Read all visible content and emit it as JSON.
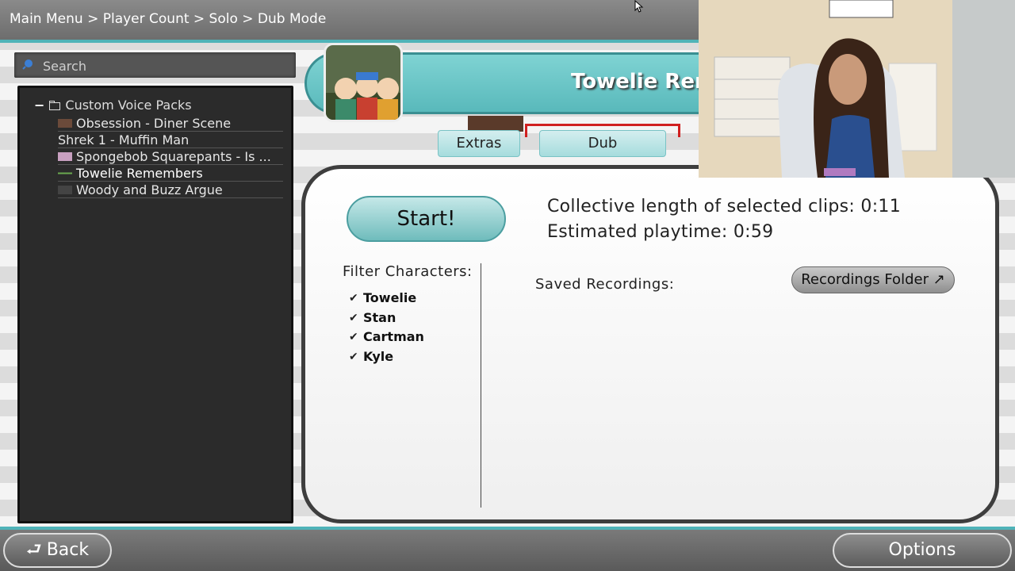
{
  "breadcrumb": "Main Menu > Player Count > Solo > Dub Mode",
  "search": {
    "placeholder": "Search"
  },
  "tree": {
    "root_label": "Custom Voice Packs",
    "items": [
      {
        "label": "Obsession - Diner Scene"
      },
      {
        "label": "Shrek 1 - Muffin Man"
      },
      {
        "label": "Spongebob Squarepants - Is ..."
      },
      {
        "label": "Towelie Remembers",
        "selected": true
      },
      {
        "label": "Woody and Buzz Argue"
      }
    ]
  },
  "clip": {
    "title": "Towelie Rer"
  },
  "tabs": {
    "extras": "Extras",
    "dub": "Dub"
  },
  "main": {
    "start_label": "Start!",
    "collective_length": "Collective length of selected clips:  0:11",
    "estimated_playtime": "Estimated playtime:  0:59",
    "filter_label": "Filter Characters:",
    "characters": [
      "Towelie",
      "Stan",
      "Cartman",
      "Kyle"
    ],
    "saved_recordings_label": "Saved Recordings:",
    "recordings_folder_label": "Recordings Folder ↗"
  },
  "footer": {
    "back_label": "Back",
    "options_label": "Options"
  },
  "colors": {
    "accent": "#4fb3b8",
    "panel": "#2b2b2b",
    "tab": "#a6dcdd"
  }
}
